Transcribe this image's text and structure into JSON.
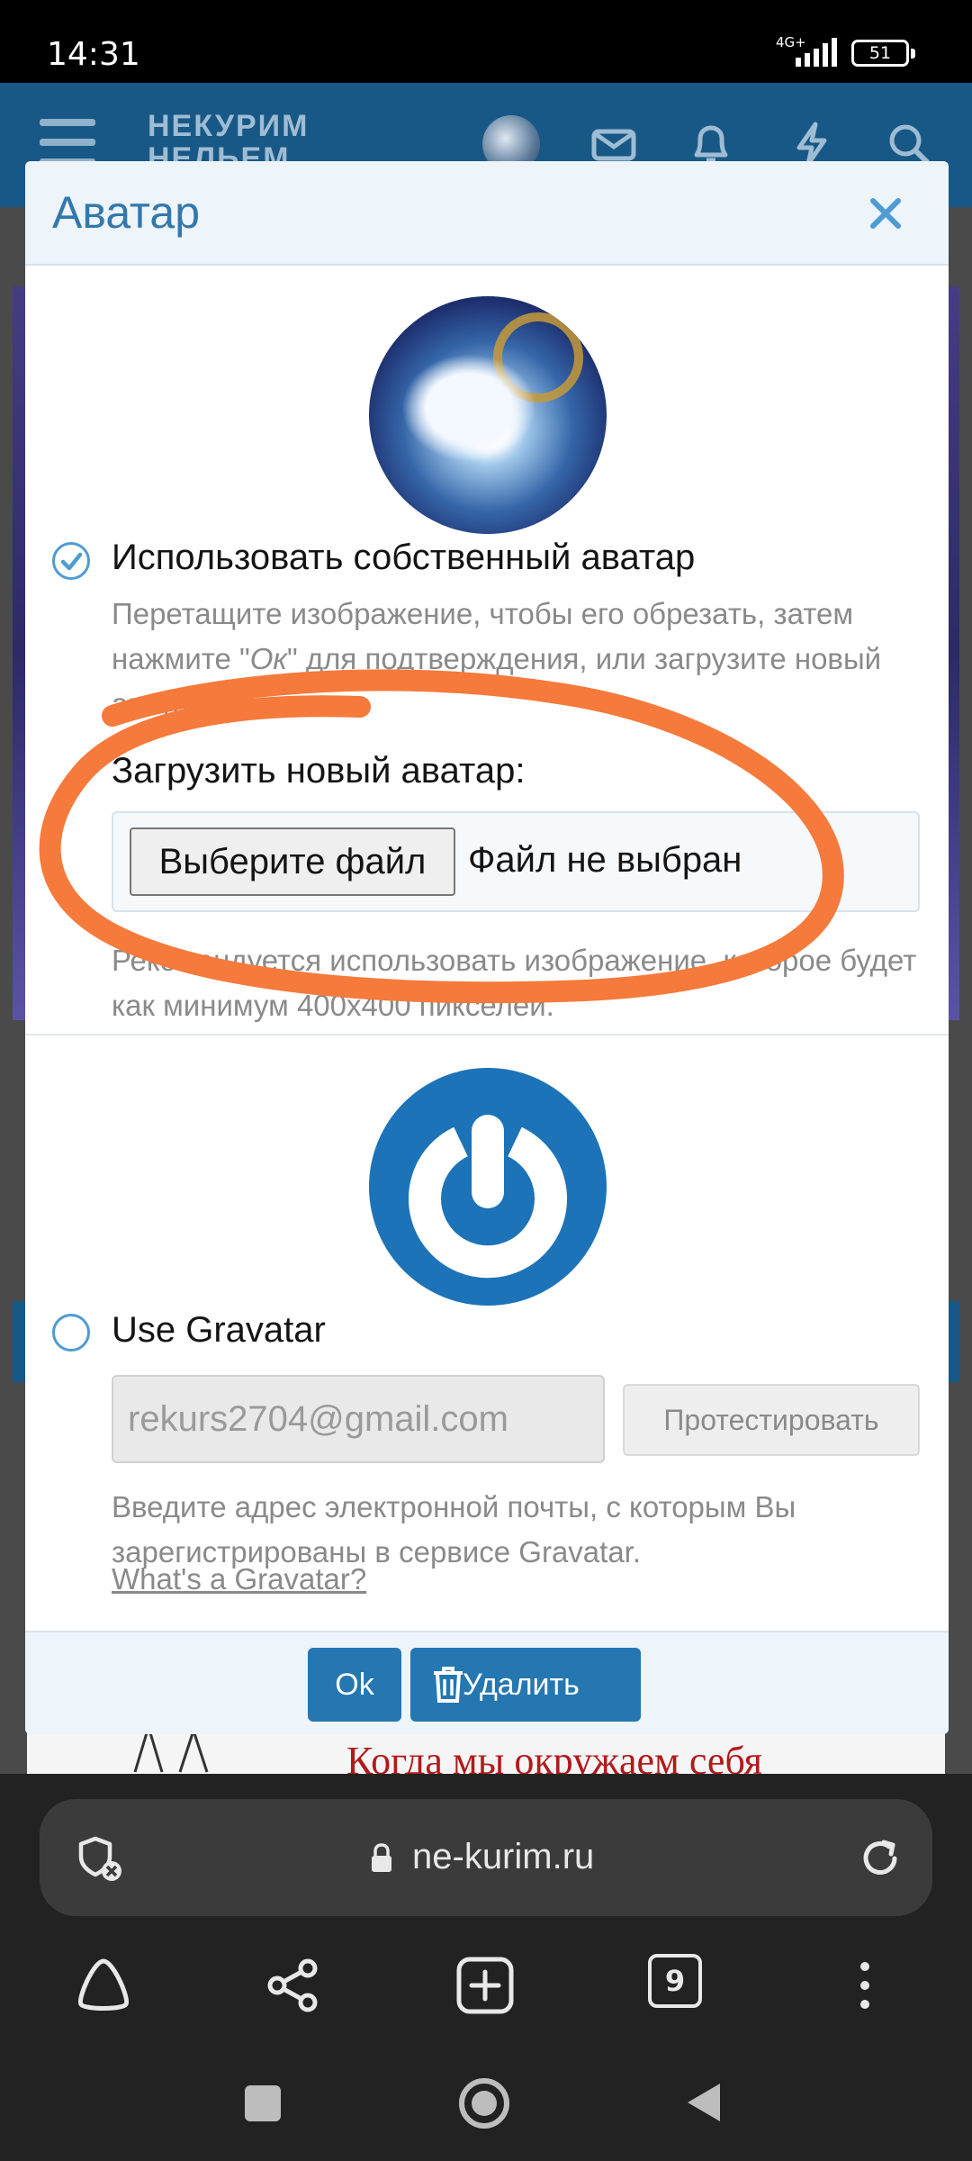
{
  "status_bar": {
    "time": "14:31",
    "network": "4G+",
    "battery": "51"
  },
  "site_header": {
    "logo": "НЕКУРИМ",
    "logo_line2": "НЕЛЬЕМ"
  },
  "dialog": {
    "title": "Аватар",
    "own_avatar": {
      "label": "Использовать собственный аватар",
      "hint_part1": "Перетащите изображение, чтобы его обрезать, затем нажмите \"",
      "hint_ok": "Ок",
      "hint_part2": "\" для подтверждения, или загрузите новый аватар ниже.",
      "upload_label": "Загрузить новый аватар:",
      "file_button": "Выберите файл",
      "file_status": "Файл не выбран",
      "recommendation": "Рекомендуется использовать изображение, которое будет как минимум 400x400 пикселей."
    },
    "gravatar": {
      "label": "Use Gravatar",
      "email_value": "rekurs2704@gmail.com",
      "test_button": "Протестировать",
      "hint": "Введите адрес электронной почты, с которым Вы зарегистрированы в сервисе Gravatar.",
      "link": "What's a Gravatar?"
    },
    "footer": {
      "ok_label": "Ok",
      "delete_label": "Удалить"
    }
  },
  "background_text": "Когда мы окружаем себя",
  "browser": {
    "url": "ne-kurim.ru",
    "tab_count": "9"
  },
  "colors": {
    "accent": "#2577b1",
    "title_blue": "#3378ad",
    "annotation_orange": "#f57a3c",
    "header_bg": "#185886"
  }
}
